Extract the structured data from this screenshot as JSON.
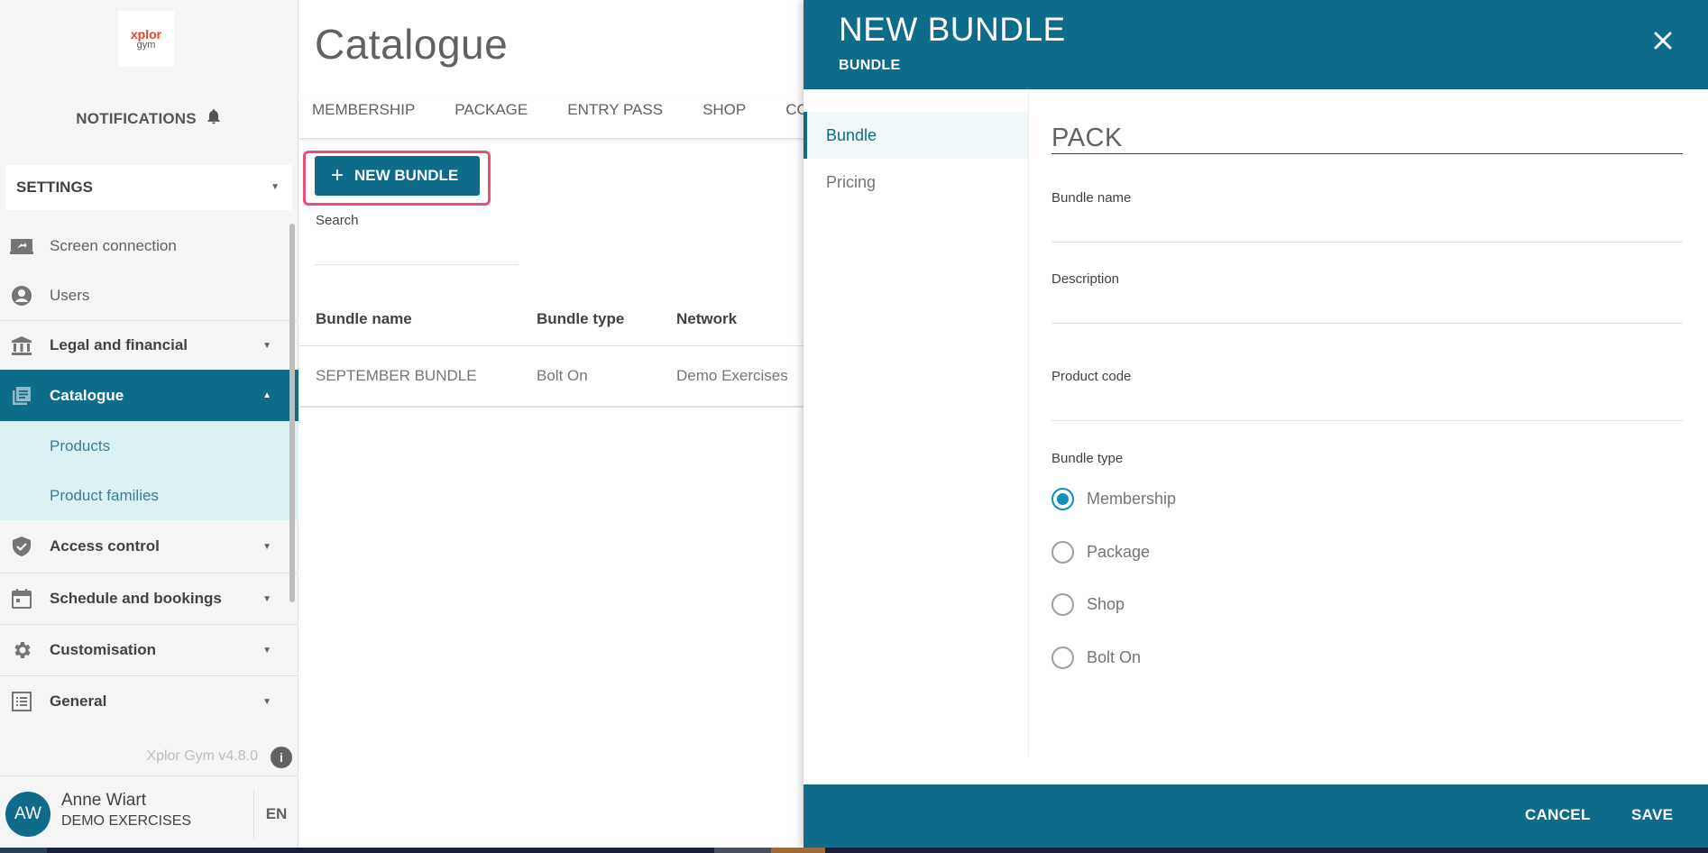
{
  "app": {
    "logo_line1": "xplor",
    "logo_line2": "gym"
  },
  "sidebar": {
    "notifications_label": "NOTIFICATIONS",
    "settings_label": "SETTINGS",
    "items": [
      {
        "label": "Screen connection",
        "icon": "screen-icon"
      },
      {
        "label": "Users",
        "icon": "user-circle-icon"
      },
      {
        "label": "Legal and financial",
        "icon": "bank-icon"
      },
      {
        "label": "Catalogue",
        "icon": "catalogue-icon"
      },
      {
        "label": "Access control",
        "icon": "shield-check-icon"
      },
      {
        "label": "Schedule and bookings",
        "icon": "calendar-icon"
      },
      {
        "label": "Customisation",
        "icon": "gear-icon"
      },
      {
        "label": "General",
        "icon": "list-icon"
      }
    ],
    "sub_items": [
      {
        "label": "Products"
      },
      {
        "label": "Product families"
      }
    ],
    "version": "Xplor Gym v4.8.0"
  },
  "user": {
    "initials": "AW",
    "name": "Anne Wiart",
    "org": "DEMO EXERCISES",
    "language": "EN"
  },
  "main": {
    "title": "Catalogue",
    "tabs": [
      {
        "label": "MEMBERSHIP"
      },
      {
        "label": "PACKAGE"
      },
      {
        "label": "ENTRY PASS"
      },
      {
        "label": "SHOP"
      },
      {
        "label": "COURSE"
      }
    ],
    "new_bundle_label": "NEW BUNDLE",
    "search_label": "Search",
    "search_value": "",
    "table": {
      "columns": [
        "Bundle name",
        "Bundle type",
        "Network"
      ],
      "rows": [
        [
          "SEPTEMBER BUNDLE",
          "Bolt On",
          "Demo Exercises"
        ]
      ]
    }
  },
  "drawer": {
    "title": "NEW BUNDLE",
    "subtitle": "BUNDLE",
    "nav": [
      {
        "label": "Bundle"
      },
      {
        "label": "Pricing"
      }
    ],
    "pack_title": "PACK",
    "fields": {
      "bundle_name": {
        "label": "Bundle name",
        "value": ""
      },
      "description": {
        "label": "Description",
        "value": ""
      },
      "product_code": {
        "label": "Product code",
        "value": ""
      }
    },
    "bundle_type_label": "Bundle type",
    "bundle_types": [
      "Membership",
      "Package",
      "Shop",
      "Bolt On"
    ],
    "selected_bundle_type": "Membership",
    "cancel_label": "CANCEL",
    "save_label": "SAVE"
  },
  "colors": {
    "primary": "#0e6b8a",
    "highlight": "#e94e7b",
    "radio_selected": "#0e8fb5",
    "sub_nav_bg": "#dcf1f3"
  }
}
